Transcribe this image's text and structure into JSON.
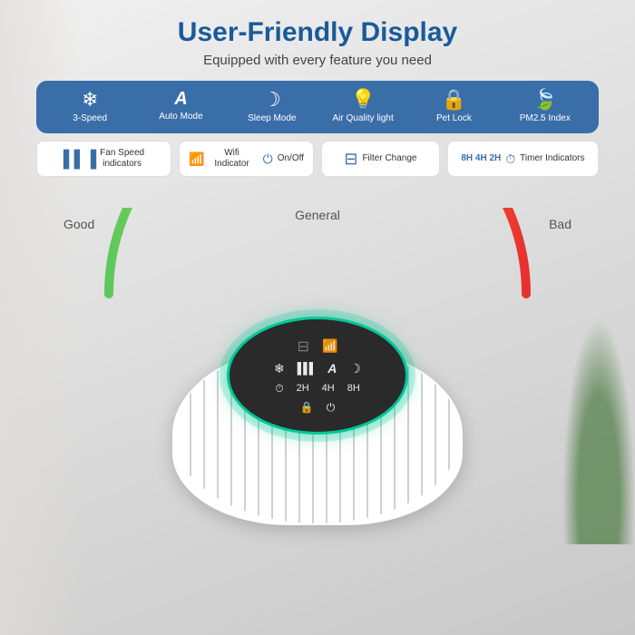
{
  "header": {
    "title": "User-Friendly Display",
    "subtitle": "Equipped with every feature you need"
  },
  "features_top": [
    {
      "icon": "✦",
      "label": "3-Speed",
      "unicode": "❄"
    },
    {
      "icon": "Ⓐ",
      "label": "Auto Mode"
    },
    {
      "icon": "☽",
      "label": "Sleep Mode"
    },
    {
      "icon": "💡",
      "label": "Air Quality light"
    },
    {
      "icon": "🔒",
      "label": "Pet Lock"
    },
    {
      "icon": "🍃",
      "label": "PM2.5 Index"
    }
  ],
  "features_bottom_left": {
    "icon": "▌▌▐",
    "label": "Fan Speed indicators"
  },
  "features_bottom_mid1": {
    "icon": "📶",
    "label": "Wifi Indicator",
    "icon2": "⏻",
    "label2": "On/Off"
  },
  "features_bottom_mid2": {
    "icon": "⊟",
    "label": "Filter Change"
  },
  "features_bottom_right": {
    "icon": "8H 4H 2H ⏱",
    "label": "Timer Indicators"
  },
  "arc": {
    "good_label": "Good",
    "general_label": "General",
    "bad_label": "Bad"
  }
}
